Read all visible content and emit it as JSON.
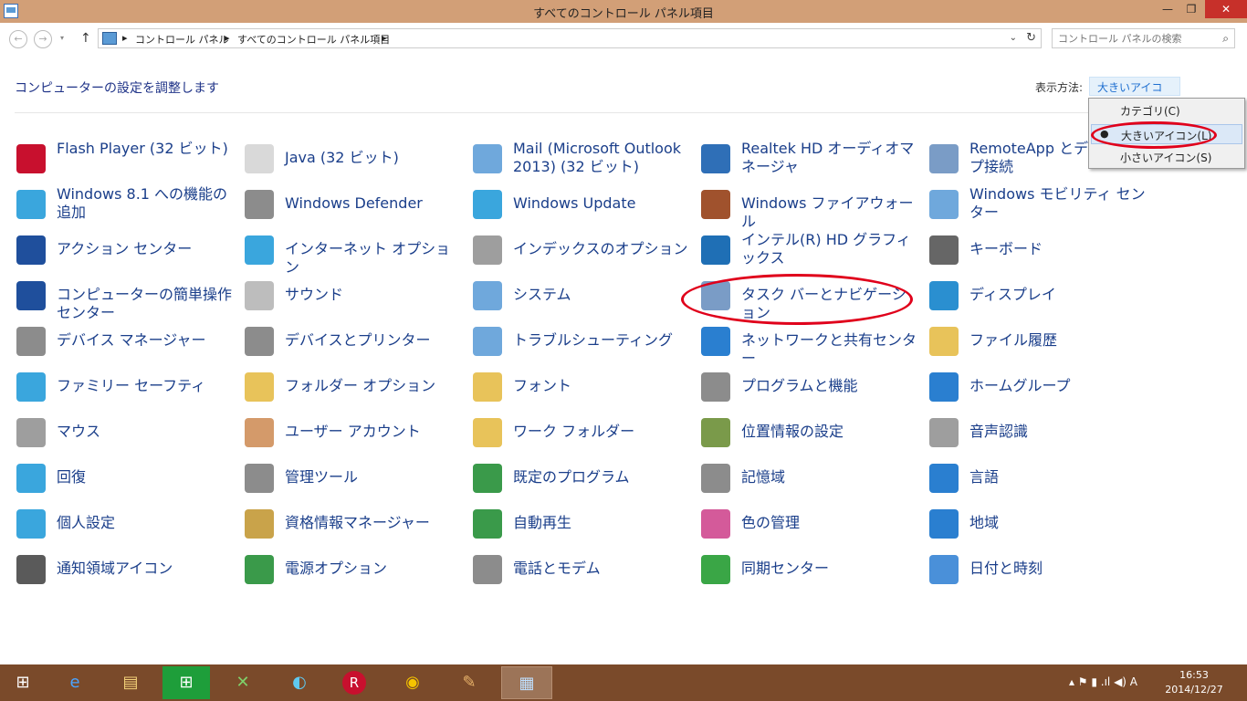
{
  "window": {
    "title": "すべてのコントロール パネル項目"
  },
  "nav": {
    "back": "←",
    "forward": "→",
    "dropdown": "▾",
    "up": "↑",
    "breadcrumb": [
      "コントロール パネル",
      "すべてのコントロール パネル項目"
    ],
    "sep": "▸",
    "address_dropdown": "⌄",
    "refresh": "↻",
    "search_placeholder": "コントロール パネルの検索",
    "search_icon": "⌕"
  },
  "header": {
    "heading": "コンピューターの設定を調整します",
    "viewby_label": "表示方法:",
    "viewby_value": "大きいアイコン ▾"
  },
  "view_menu": {
    "items": [
      "カテゴリ(C)",
      "大きいアイコン(L)",
      "小さいアイコン(S)"
    ],
    "selected_bullet": "●"
  },
  "items": [
    [
      "Flash Player (32 ビット)",
      "Java (32 ビット)",
      "Mail (Microsoft Outlook 2013) (32 ビット)",
      "Realtek HD オーディオマネージャ",
      "RemoteApp とデスクトップ接続"
    ],
    [
      "Windows 8.1 への機能の追加",
      "Windows Defender",
      "Windows Update",
      "Windows ファイアウォール",
      "Windows モビリティ センター"
    ],
    [
      "アクション センター",
      "インターネット オプション",
      "インデックスのオプション",
      "インテル(R) HD グラフィックス",
      "キーボード"
    ],
    [
      "コンピューターの簡単操作センター",
      "サウンド",
      "システム",
      "タスク バーとナビゲーション",
      "ディスプレイ"
    ],
    [
      "デバイス マネージャー",
      "デバイスとプリンター",
      "トラブルシューティング",
      "ネットワークと共有センター",
      "ファイル履歴"
    ],
    [
      "ファミリー セーフティ",
      "フォルダー オプション",
      "フォント",
      "プログラムと機能",
      "ホームグループ"
    ],
    [
      "マウス",
      "ユーザー アカウント",
      "ワーク フォルダー",
      "位置情報の設定",
      "音声認識"
    ],
    [
      "回復",
      "管理ツール",
      "既定のプログラム",
      "記憶域",
      "言語"
    ],
    [
      "個人設定",
      "資格情報マネージャー",
      "自動再生",
      "色の管理",
      "地域"
    ],
    [
      "通知領域アイコン",
      "電源オプション",
      "電話とモデム",
      "同期センター",
      "日付と時刻"
    ]
  ],
  "taskbar": {
    "start": "⊞",
    "apps": [
      "e",
      "▤",
      "⊞",
      "✕",
      "◐",
      "R",
      "◉",
      "✎",
      "▦"
    ],
    "tray": "▴  ⚑  ▮  .ıl  ◀)  A",
    "time": "16:53",
    "date": "2014/12/27"
  },
  "colors": {
    "titlebar": "#d29f77",
    "taskbar": "#7a4a2a",
    "link": "#1a3e8a",
    "highlight": "#e0001b"
  }
}
